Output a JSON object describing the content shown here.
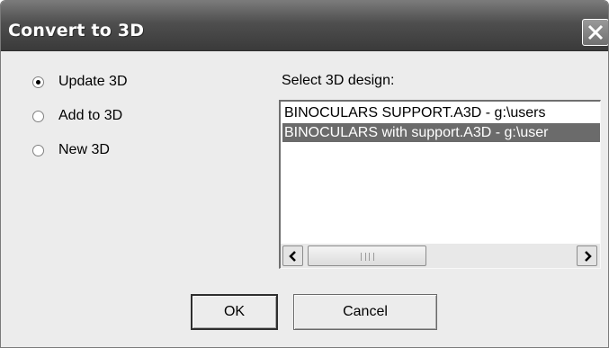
{
  "window": {
    "title": "Convert to 3D",
    "close_icon": "close-x-icon"
  },
  "options": [
    {
      "label": "Update 3D",
      "selected": true
    },
    {
      "label": "Add to 3D",
      "selected": false
    },
    {
      "label": "New 3D",
      "selected": false
    }
  ],
  "design_list": {
    "label": "Select 3D design:",
    "items": [
      {
        "text": "BINOCULARS SUPPORT.A3D - g:\\users",
        "selected": false
      },
      {
        "text": "BINOCULARS with support.A3D - g:\\user",
        "selected": true
      }
    ]
  },
  "buttons": {
    "ok": "OK",
    "cancel": "Cancel"
  },
  "colors": {
    "titlebar": "#4e4e4e",
    "selection": "#6b6b6b",
    "dialog_bg": "#ececec"
  }
}
